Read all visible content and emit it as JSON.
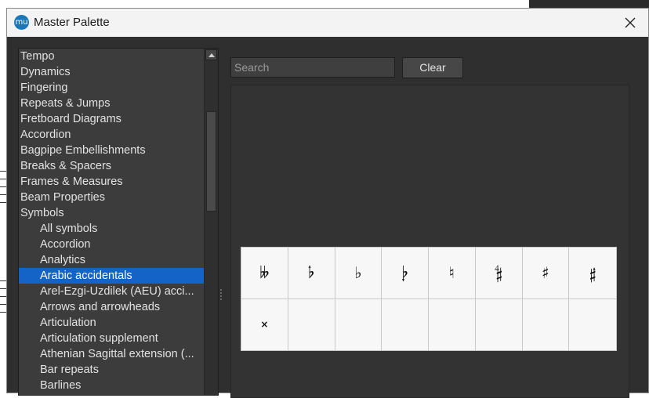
{
  "window": {
    "title": "Master Palette",
    "icon_glyph": "mu"
  },
  "tree": {
    "items": [
      {
        "label": "Tempo",
        "child": false,
        "selected": false
      },
      {
        "label": "Dynamics",
        "child": false,
        "selected": false
      },
      {
        "label": "Fingering",
        "child": false,
        "selected": false
      },
      {
        "label": "Repeats & Jumps",
        "child": false,
        "selected": false
      },
      {
        "label": "Fretboard Diagrams",
        "child": false,
        "selected": false
      },
      {
        "label": "Accordion",
        "child": false,
        "selected": false
      },
      {
        "label": "Bagpipe Embellishments",
        "child": false,
        "selected": false
      },
      {
        "label": "Breaks & Spacers",
        "child": false,
        "selected": false
      },
      {
        "label": "Frames & Measures",
        "child": false,
        "selected": false
      },
      {
        "label": "Beam Properties",
        "child": false,
        "selected": false
      },
      {
        "label": "Symbols",
        "child": false,
        "selected": false
      },
      {
        "label": "All symbols",
        "child": true,
        "selected": false
      },
      {
        "label": "Accordion",
        "child": true,
        "selected": false
      },
      {
        "label": "Analytics",
        "child": true,
        "selected": false
      },
      {
        "label": "Arabic accidentals",
        "child": true,
        "selected": true
      },
      {
        "label": "Arel-Ezgi-Uzdilek (AEU) acci...",
        "child": true,
        "selected": false
      },
      {
        "label": "Arrows and arrowheads",
        "child": true,
        "selected": false
      },
      {
        "label": "Articulation",
        "child": true,
        "selected": false
      },
      {
        "label": "Articulation supplement",
        "child": true,
        "selected": false
      },
      {
        "label": "Athenian Sagittal extension (...",
        "child": true,
        "selected": false
      },
      {
        "label": "Bar repeats",
        "child": true,
        "selected": false
      },
      {
        "label": "Barlines",
        "child": true,
        "selected": false
      }
    ]
  },
  "search": {
    "placeholder": "Search",
    "value": ""
  },
  "clear_label": "Clear",
  "palette": {
    "cells": [
      {
        "glyph": "𝄫",
        "name": "double-flat"
      },
      {
        "glyph": "𝄬",
        "name": "three-quarter-flat"
      },
      {
        "glyph": "♭",
        "name": "flat"
      },
      {
        "glyph": "𝄭",
        "name": "quarter-flat"
      },
      {
        "glyph": "♮",
        "name": "natural"
      },
      {
        "glyph": "𝄲",
        "name": "quarter-sharp"
      },
      {
        "glyph": "♯",
        "name": "sharp"
      },
      {
        "glyph": "𝄰",
        "name": "three-quarter-sharp"
      },
      {
        "glyph": "×",
        "name": "double-sharp"
      },
      {
        "glyph": "",
        "name": "empty"
      },
      {
        "glyph": "",
        "name": "empty"
      },
      {
        "glyph": "",
        "name": "empty"
      },
      {
        "glyph": "",
        "name": "empty"
      },
      {
        "glyph": "",
        "name": "empty"
      },
      {
        "glyph": "",
        "name": "empty"
      },
      {
        "glyph": "",
        "name": "empty"
      }
    ]
  },
  "colors": {
    "selection": "#1464c8",
    "panel": "#3c3c3c",
    "background": "#2f2f2f"
  }
}
